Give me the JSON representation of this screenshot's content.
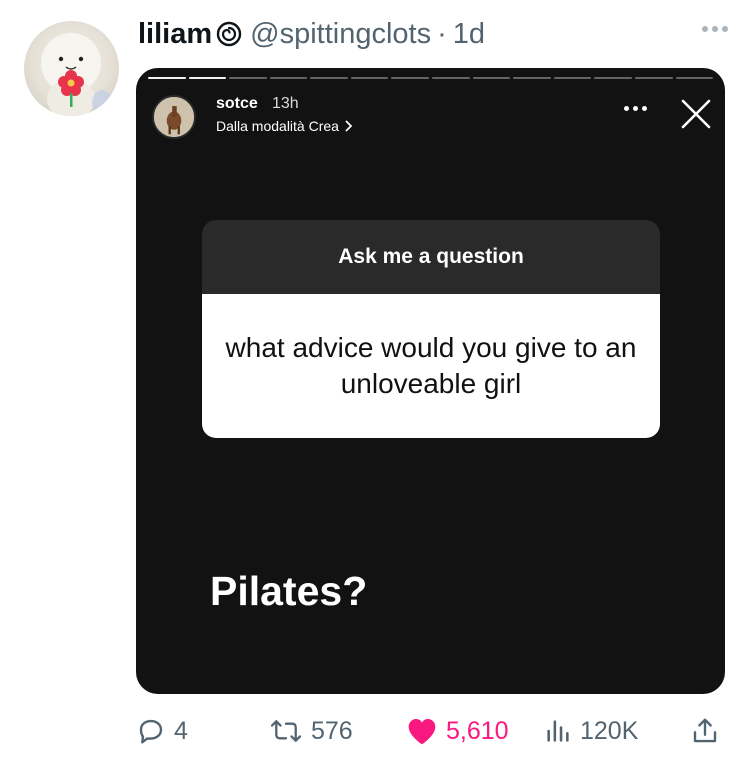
{
  "tweet": {
    "display_name": "liliam",
    "name_emoji": "spiral-emoji",
    "handle": "@spittingclots",
    "separator": "·",
    "time": "1d"
  },
  "story": {
    "username": "sotce",
    "time": "13h",
    "subtitle": "Dalla modalità Crea",
    "question_title": "Ask me a question",
    "question_text": "what advice would you give to an unloveable girl",
    "answer": "Pilates?"
  },
  "actions": {
    "replies": "4",
    "retweets": "576",
    "likes": "5,610",
    "views": "120K"
  },
  "colors": {
    "like": "#f91880",
    "muted": "#536471",
    "story_bg": "#121212"
  },
  "icons": [
    "reply-icon",
    "retweet-icon",
    "heart-icon",
    "views-icon",
    "share-icon",
    "close-icon",
    "more-icon"
  ]
}
